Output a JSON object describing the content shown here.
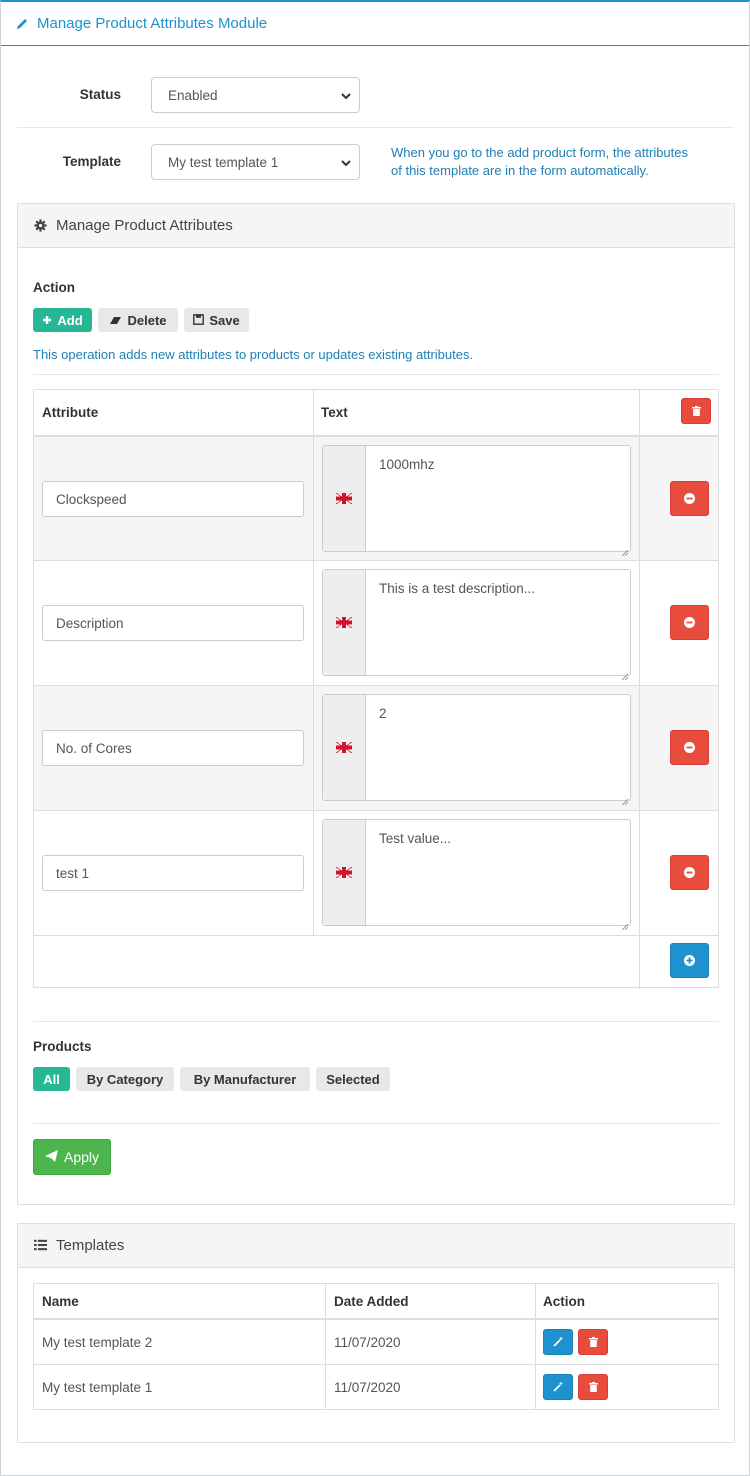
{
  "module": {
    "title": "Manage Product Attributes Module"
  },
  "form": {
    "status_label": "Status",
    "status_value": "Enabled",
    "template_label": "Template",
    "template_value": "My test template 1",
    "template_help_line1": "When you go to the add product form, the attributes",
    "template_help_line2": "of this template are in the form automatically."
  },
  "attributes_panel": {
    "title": "Manage Product Attributes",
    "action_label": "Action",
    "add_label": "Add",
    "delete_label": "Delete",
    "save_label": "Save",
    "info": "This operation adds new attributes to products or updates existing attributes.",
    "col_attribute": "Attribute",
    "col_text": "Text",
    "rows": [
      {
        "attribute": "Clockspeed",
        "text": "1000mhz"
      },
      {
        "attribute": "Description",
        "text": "This is a test description..."
      },
      {
        "attribute": "No. of Cores",
        "text": "2"
      },
      {
        "attribute": "test 1",
        "text": "Test value..."
      }
    ],
    "products_label": "Products",
    "products_filters": [
      "All",
      "By Category",
      "By Manufacturer",
      "Selected"
    ],
    "products_selected": "All",
    "apply_label": "Apply"
  },
  "templates_panel": {
    "title": "Templates",
    "col_name": "Name",
    "col_date": "Date Added",
    "col_action": "Action",
    "rows": [
      {
        "name": "My test template 2",
        "date": "11/07/2020"
      },
      {
        "name": "My test template 1",
        "date": "11/07/2020"
      }
    ]
  },
  "colors": {
    "accent": "#1e91cf",
    "success": "#26b894",
    "danger": "#e74c3c",
    "apply": "#4cb64c"
  }
}
